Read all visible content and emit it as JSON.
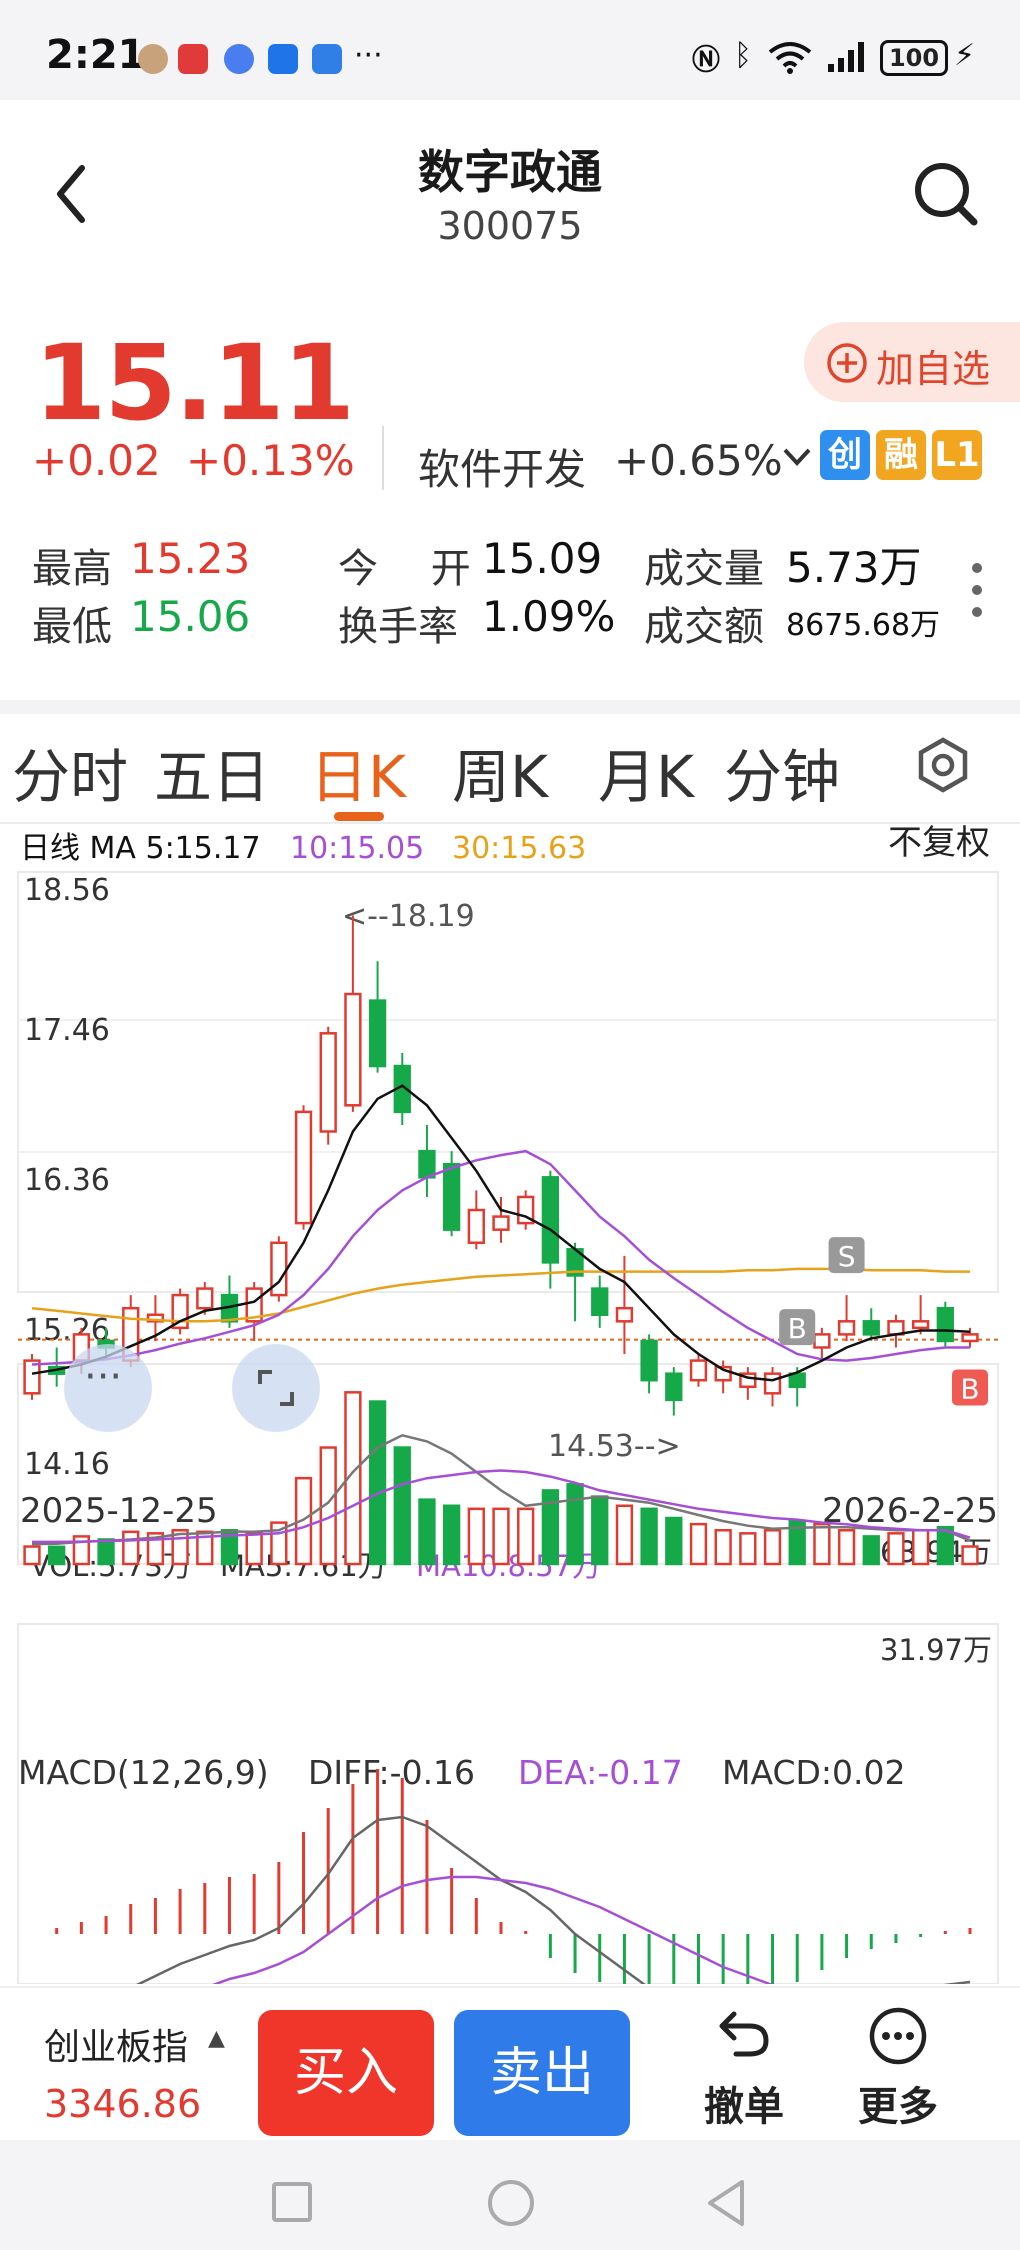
{
  "status_bar": {
    "time": "2:21",
    "battery": "100"
  },
  "header": {
    "title": "数字政通",
    "code": "300075"
  },
  "quote": {
    "price": "15.11",
    "change": "+0.02",
    "change_pct": "+0.13%",
    "sector": "软件开发",
    "sector_change": "+0.65%",
    "badges": [
      "创",
      "融",
      "L1"
    ],
    "add_watchlist": "加自选"
  },
  "stats": {
    "high_label": "最高",
    "high": "15.23",
    "low_label": "最低",
    "low": "15.06",
    "open_label": "今　 开",
    "open": "15.09",
    "turnover_label": "换手率",
    "turnover": "1.09%",
    "volume_label": "成交量",
    "volume": "5.73万",
    "amount_label": "成交额",
    "amount": "8675.68万"
  },
  "tabs": [
    "分时",
    "五日",
    "日K",
    "周K",
    "月K",
    "分钟"
  ],
  "active_tab": "日K",
  "chart_header": {
    "ma5": "日线 MA 5:15.17",
    "ma10": "10:15.05",
    "ma30": "30:15.63",
    "adjust": "不复权"
  },
  "colors": {
    "up": "#e23a2f",
    "down": "#16a94a",
    "ma5": "#111111",
    "ma10": "#a64fd6",
    "ma30": "#e8a21a",
    "accent": "#e8621c"
  },
  "chart_data": {
    "type": "candlestick",
    "y_ticks": [
      "18.56",
      "17.46",
      "16.36",
      "15.26",
      "14.16"
    ],
    "ylim": [
      14.16,
      18.56
    ],
    "x_start": "2025-12-25",
    "x_end": "2026-2-25",
    "high_annotation": "<--18.19",
    "low_annotation": "14.53-->",
    "current_price": 15.11,
    "signals": [
      "S",
      "B",
      "B"
    ],
    "candles": [
      {
        "o": 14.7,
        "c": 14.95,
        "h": 15.0,
        "l": 14.65
      },
      {
        "o": 14.9,
        "c": 14.85,
        "h": 15.05,
        "l": 14.75
      },
      {
        "o": 14.95,
        "c": 15.15,
        "h": 15.2,
        "l": 14.85
      },
      {
        "o": 15.1,
        "c": 15.05,
        "h": 15.2,
        "l": 14.95
      },
      {
        "o": 14.95,
        "c": 15.35,
        "h": 15.45,
        "l": 14.9
      },
      {
        "o": 15.25,
        "c": 15.3,
        "h": 15.45,
        "l": 15.1
      },
      {
        "o": 15.2,
        "c": 15.45,
        "h": 15.5,
        "l": 15.15
      },
      {
        "o": 15.35,
        "c": 15.5,
        "h": 15.55,
        "l": 15.3
      },
      {
        "o": 15.45,
        "c": 15.25,
        "h": 15.6,
        "l": 15.2
      },
      {
        "o": 15.25,
        "c": 15.5,
        "h": 15.55,
        "l": 15.1
      },
      {
        "o": 15.45,
        "c": 15.85,
        "h": 15.9,
        "l": 15.4
      },
      {
        "o": 16.0,
        "c": 16.85,
        "h": 16.9,
        "l": 15.95
      },
      {
        "o": 16.7,
        "c": 17.45,
        "h": 17.5,
        "l": 16.6
      },
      {
        "o": 16.9,
        "c": 17.75,
        "h": 18.35,
        "l": 16.85
      },
      {
        "o": 17.7,
        "c": 17.2,
        "h": 18.0,
        "l": 17.15
      },
      {
        "o": 17.2,
        "c": 16.85,
        "h": 17.3,
        "l": 16.75
      },
      {
        "o": 16.55,
        "c": 16.35,
        "h": 16.75,
        "l": 16.2
      },
      {
        "o": 16.45,
        "c": 15.95,
        "h": 16.55,
        "l": 15.9
      },
      {
        "o": 15.85,
        "c": 16.1,
        "h": 16.25,
        "l": 15.8
      },
      {
        "o": 15.95,
        "c": 16.05,
        "h": 16.2,
        "l": 15.85
      },
      {
        "o": 16.0,
        "c": 16.2,
        "h": 16.25,
        "l": 15.95
      },
      {
        "o": 16.35,
        "c": 15.7,
        "h": 16.4,
        "l": 15.5
      },
      {
        "o": 15.8,
        "c": 15.6,
        "h": 15.85,
        "l": 15.25
      },
      {
        "o": 15.5,
        "c": 15.3,
        "h": 15.6,
        "l": 15.2
      },
      {
        "o": 15.25,
        "c": 15.35,
        "h": 15.75,
        "l": 15.0
      },
      {
        "o": 15.1,
        "c": 14.8,
        "h": 15.15,
        "l": 14.7
      },
      {
        "o": 14.85,
        "c": 14.65,
        "h": 14.9,
        "l": 14.53
      },
      {
        "o": 14.8,
        "c": 14.95,
        "h": 15.0,
        "l": 14.75
      },
      {
        "o": 14.8,
        "c": 14.9,
        "h": 14.95,
        "l": 14.7
      },
      {
        "o": 14.75,
        "c": 14.85,
        "h": 14.9,
        "l": 14.65
      },
      {
        "o": 14.7,
        "c": 14.85,
        "h": 14.9,
        "l": 14.6
      },
      {
        "o": 14.85,
        "c": 14.75,
        "h": 14.9,
        "l": 14.6
      },
      {
        "o": 15.05,
        "c": 15.15,
        "h": 15.2,
        "l": 14.95
      },
      {
        "o": 15.15,
        "c": 15.25,
        "h": 15.45,
        "l": 15.1
      },
      {
        "o": 15.25,
        "c": 15.15,
        "h": 15.35,
        "l": 15.1
      },
      {
        "o": 15.15,
        "c": 15.25,
        "h": 15.3,
        "l": 15.05
      },
      {
        "o": 15.2,
        "c": 15.25,
        "h": 15.45,
        "l": 15.15
      },
      {
        "o": 15.35,
        "c": 15.1,
        "h": 15.4,
        "l": 15.05
      },
      {
        "o": 15.1,
        "c": 15.15,
        "h": 15.2,
        "l": 15.05
      }
    ],
    "ma5": [
      14.85,
      14.88,
      14.92,
      14.98,
      15.06,
      15.14,
      15.25,
      15.33,
      15.36,
      15.4,
      15.55,
      15.85,
      16.25,
      16.7,
      16.95,
      17.05,
      16.9,
      16.65,
      16.4,
      16.1,
      16.05,
      15.95,
      15.8,
      15.65,
      15.55,
      15.35,
      15.15,
      15.0,
      14.88,
      14.82,
      14.8,
      14.86,
      14.95,
      15.05,
      15.12,
      15.15,
      15.18,
      15.18,
      15.17
    ],
    "ma10": [
      14.92,
      14.93,
      14.94,
      14.96,
      14.99,
      15.03,
      15.08,
      15.12,
      15.17,
      15.22,
      15.3,
      15.45,
      15.65,
      15.9,
      16.1,
      16.25,
      16.35,
      16.42,
      16.48,
      16.52,
      16.55,
      16.45,
      16.25,
      16.05,
      15.9,
      15.72,
      15.58,
      15.45,
      15.32,
      15.2,
      15.1,
      15.0,
      14.96,
      14.95,
      14.97,
      15.0,
      15.03,
      15.05,
      15.05
    ],
    "ma30": [
      15.35,
      15.33,
      15.31,
      15.29,
      15.27,
      15.26,
      15.25,
      15.25,
      15.26,
      15.28,
      15.31,
      15.36,
      15.41,
      15.46,
      15.5,
      15.53,
      15.55,
      15.57,
      15.59,
      15.6,
      15.61,
      15.62,
      15.63,
      15.63,
      15.63,
      15.63,
      15.63,
      15.63,
      15.63,
      15.64,
      15.64,
      15.65,
      15.65,
      15.65,
      15.64,
      15.64,
      15.64,
      15.63,
      15.63
    ]
  },
  "volume": {
    "vol_label": "VOL:5.73万",
    "ma5_label": "MA5:7.61万",
    "ma10_label": "MA10:8.57万",
    "max_label": "63.94万",
    "mid_label": "31.97万",
    "values": [
      5.7,
      5.6,
      9.0,
      8.0,
      10.5,
      10.0,
      11.0,
      10.5,
      11.0,
      10.0,
      13.5,
      28.0,
      38.0,
      56.0,
      53.0,
      38.0,
      21.0,
      19.0,
      18.0,
      18.0,
      18.0,
      24.0,
      26.0,
      22.0,
      19.0,
      18.0,
      15.0,
      13.0,
      11.0,
      10.0,
      11.0,
      14.0,
      13.0,
      11.0,
      9.0,
      10.0,
      11.0,
      12.0,
      5.7
    ],
    "ma5": [
      6.5,
      6.6,
      7.2,
      7.6,
      8.0,
      8.6,
      9.8,
      10.0,
      10.6,
      10.5,
      11.0,
      14.5,
      20.0,
      30.0,
      38.0,
      42.0,
      40.0,
      36.0,
      30.0,
      24.0,
      19.0,
      20.0,
      21.0,
      22.0,
      21.0,
      20.0,
      18.0,
      16.0,
      14.0,
      12.5,
      11.5,
      11.8,
      12.0,
      12.0,
      11.5,
      11.0,
      11.0,
      11.0,
      7.6
    ],
    "ma10": [
      7.2,
      7.2,
      7.3,
      7.5,
      7.7,
      8.0,
      8.4,
      8.9,
      9.3,
      9.6,
      10.0,
      12.0,
      15.0,
      19.0,
      23.0,
      26.0,
      28.0,
      29.0,
      30.0,
      30.5,
      30.0,
      28.5,
      26.5,
      24.0,
      22.5,
      21.0,
      19.5,
      18.0,
      17.0,
      16.0,
      15.0,
      14.5,
      13.5,
      13.0,
      12.0,
      11.5,
      11.0,
      11.0,
      8.6
    ]
  },
  "macd": {
    "label": "MACD(12,26,9)",
    "diff_label": "DIFF:-0.16",
    "dea_label": "DEA:-0.17",
    "macd_label": "MACD:0.02",
    "hist": [
      0.0,
      0.02,
      0.04,
      0.06,
      0.1,
      0.12,
      0.15,
      0.17,
      0.19,
      0.2,
      0.24,
      0.34,
      0.42,
      0.5,
      0.55,
      0.52,
      0.38,
      0.22,
      0.12,
      0.04,
      0.01,
      -0.08,
      -0.13,
      -0.16,
      -0.18,
      -0.2,
      -0.22,
      -0.24,
      -0.24,
      -0.22,
      -0.2,
      -0.16,
      -0.12,
      -0.08,
      -0.05,
      -0.03,
      -0.01,
      0.01,
      0.02
    ],
    "diff": [
      -0.3,
      -0.28,
      -0.25,
      -0.22,
      -0.18,
      -0.14,
      -0.1,
      -0.07,
      -0.04,
      -0.02,
      0.02,
      0.1,
      0.2,
      0.32,
      0.38,
      0.39,
      0.36,
      0.3,
      0.24,
      0.18,
      0.14,
      0.08,
      0.0,
      -0.06,
      -0.12,
      -0.18,
      -0.24,
      -0.3,
      -0.34,
      -0.36,
      -0.37,
      -0.35,
      -0.32,
      -0.28,
      -0.24,
      -0.21,
      -0.19,
      -0.17,
      -0.16
    ],
    "dea": [
      -0.32,
      -0.31,
      -0.3,
      -0.28,
      -0.26,
      -0.23,
      -0.2,
      -0.18,
      -0.15,
      -0.13,
      -0.1,
      -0.06,
      0.0,
      0.06,
      0.12,
      0.16,
      0.18,
      0.19,
      0.19,
      0.18,
      0.17,
      0.15,
      0.12,
      0.09,
      0.05,
      0.01,
      -0.03,
      -0.07,
      -0.11,
      -0.14,
      -0.17,
      -0.19,
      -0.2,
      -0.2,
      -0.2,
      -0.19,
      -0.18,
      -0.18,
      -0.17
    ]
  },
  "bottom": {
    "index_name": "创业板指",
    "index_value": "3346.86",
    "buy": "买入",
    "sell": "卖出",
    "cancel": "撤单",
    "more": "更多"
  }
}
